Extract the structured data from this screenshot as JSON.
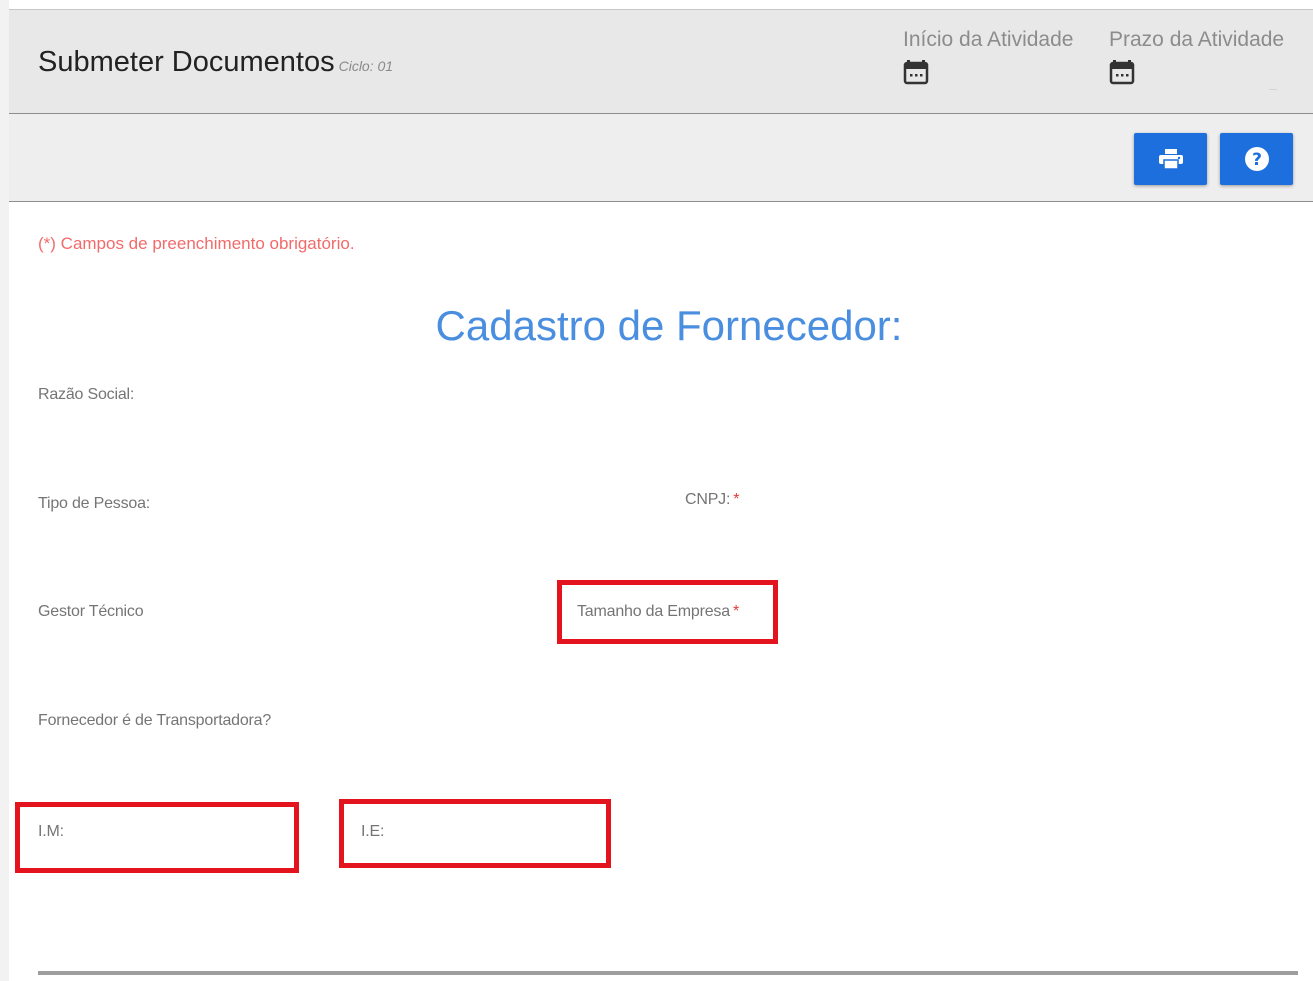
{
  "header": {
    "title": "Submeter Documentos",
    "cycle": "Ciclo: 01",
    "start_label": "Início da Atividade",
    "deadline_label": "Prazo da Atividade",
    "deadline_value": "–"
  },
  "toolbar": {
    "print_icon": "printer-icon",
    "help_icon": "question-circle-icon"
  },
  "form": {
    "required_note": "(*) Campos de preenchimento obrigatório.",
    "title": "Cadastro de Fornecedor:",
    "fields": {
      "razao_social": "Razão Social:",
      "tipo_pessoa": "Tipo de Pessoa:",
      "cnpj": "CNPJ:",
      "gestor_tecnico": "Gestor Técnico",
      "tamanho_empresa": "Tamanho da Empresa",
      "transportadora": "Fornecedor é de Transportadora?",
      "im": "I.M:",
      "ie": "I.E:"
    },
    "required_marker": "*"
  },
  "colors": {
    "accent": "#1d6fdd",
    "title_blue": "#4a8ee0",
    "required_red": "#f26a6a",
    "highlight_red": "#e3141e"
  }
}
